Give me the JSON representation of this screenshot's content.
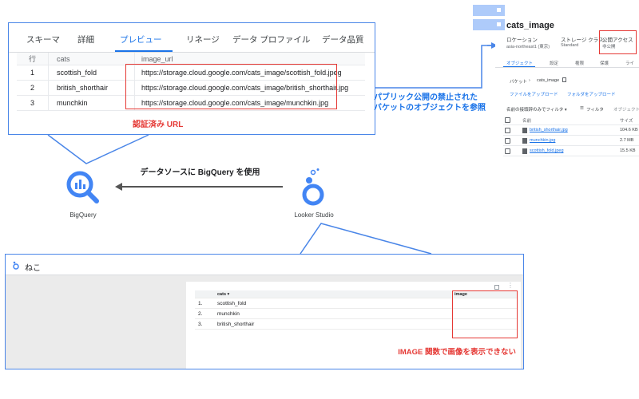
{
  "bigquery_preview": {
    "tabs": [
      {
        "label": "スキーマ"
      },
      {
        "label": "詳細"
      },
      {
        "label": "プレビュー"
      },
      {
        "label": "リネージ"
      },
      {
        "label": "データ プロファイル"
      },
      {
        "label": "データ品質"
      }
    ],
    "active_tab": "プレビュー",
    "columns": [
      "行",
      "cats",
      "image_url"
    ],
    "rows": [
      {
        "row": "1",
        "cats": "scottish_fold",
        "image_url": "https://storage.cloud.google.com/cats_image/scottish_fold.jpeg"
      },
      {
        "row": "2",
        "cats": "british_shorthair",
        "image_url": "https://storage.cloud.google.com/cats_image/british_shorthair.jpg"
      },
      {
        "row": "3",
        "cats": "munchkin",
        "image_url": "https://storage.cloud.google.com/cats_image/munchkin.jpg"
      }
    ],
    "auth_url_label": "認証済み URL"
  },
  "storage": {
    "bucket_name": "cats_image",
    "location_label": "ロケーション",
    "location_value": "asia-northeast1 (東京)",
    "storage_class_label": "ストレージ クラス",
    "storage_class_value": "Standard",
    "public_access_label": "公開アクセス",
    "public_access_value": "非公開",
    "tabs": [
      "オブジェクト",
      "設定",
      "権限",
      "保護",
      "ライ"
    ],
    "breadcrumb_root": "バケット",
    "breadcrumb_sep": "›",
    "breadcrumb_current": "cats_image",
    "upload_file": "ファイルをアップロード",
    "upload_folder": "フォルダをアップロード",
    "filter_prefix": "名前の接頭辞のみでフィルタ ▾",
    "filter_label": "フィルタ",
    "filter_objects": "オブジェクト",
    "col_name": "名前",
    "col_size": "サイズ",
    "files": [
      {
        "name": "british_shorthair.jpg",
        "size": "104.6 KB"
      },
      {
        "name": "munchkin.jpg",
        "size": "2.7 MB"
      },
      {
        "name": "scottish_fold.jpeg",
        "size": "15.5 KB"
      }
    ]
  },
  "flow": {
    "public_block_label": "パブリック公開の禁止された\nバケットのオブジェクトを参照",
    "datasource_label": "データソースに BigQuery を使用",
    "bigquery_label": "BigQuery",
    "looker_label": "Looker Studio"
  },
  "looker_report": {
    "title": "ねこ",
    "columns": [
      "",
      "cats ▾",
      "image"
    ],
    "rows": [
      {
        "index": "1.",
        "cats": "scottish_fold"
      },
      {
        "index": "2.",
        "cats": "munchkin"
      },
      {
        "index": "3.",
        "cats": "british_shorthair"
      }
    ],
    "error_label": "IMAGE 関数で画像を表示できない"
  },
  "colors": {
    "accent_blue": "#4a86e8",
    "link_blue": "#1a73e8",
    "highlight_red": "#e53935",
    "bigquery_blue": "#4285f4",
    "bucket_blue": "#aecbfa"
  }
}
